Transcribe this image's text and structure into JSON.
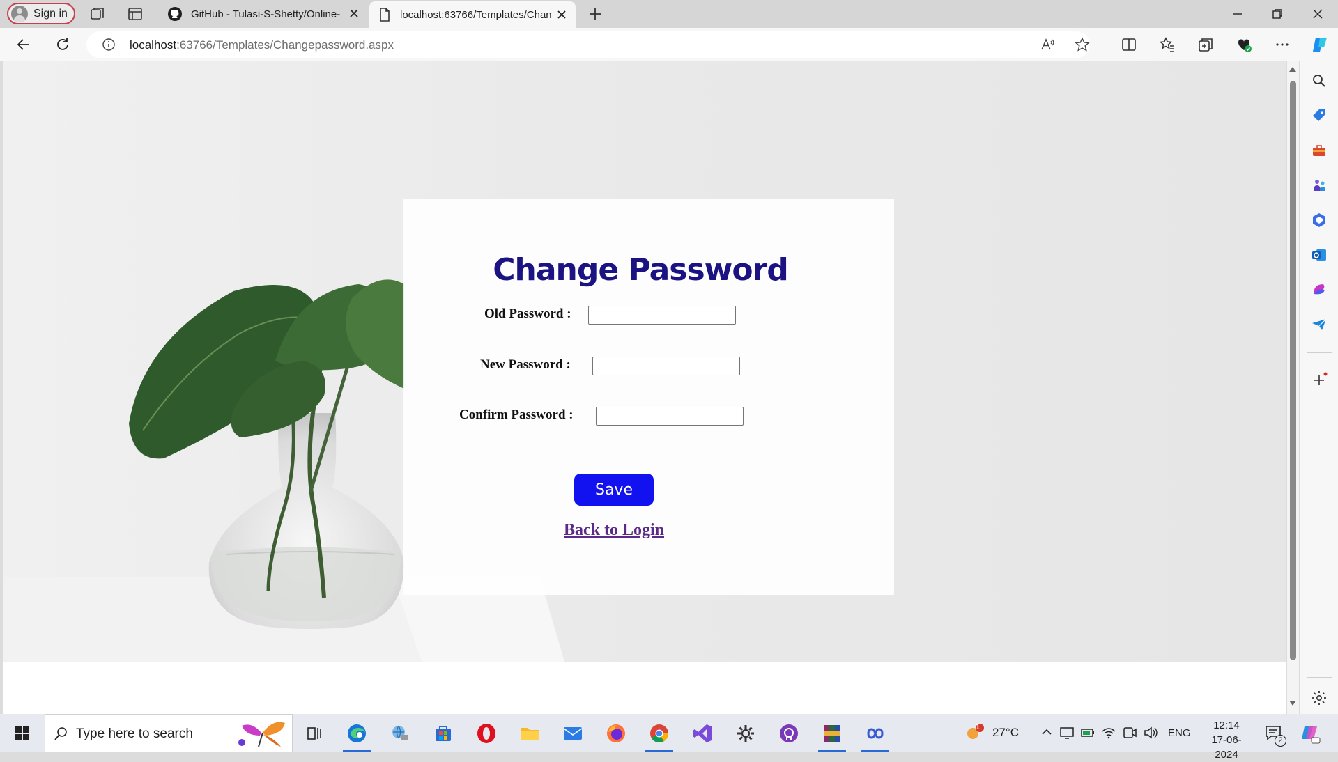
{
  "browser": {
    "signin_label": "Sign in",
    "tabs": [
      {
        "title": "GitHub - Tulasi-S-Shetty/Online-"
      },
      {
        "title": "localhost:63766/Templates/Chan"
      }
    ],
    "url_host": "localhost",
    "url_rest": ":63766/Templates/Changepassword.aspx"
  },
  "page": {
    "title": "Change Password",
    "fields": [
      {
        "label": "Old Password :",
        "value": ""
      },
      {
        "label": "New Password :",
        "value": ""
      },
      {
        "label": "Confirm Password :",
        "value": ""
      }
    ],
    "save_label": "Save",
    "back_link": "Back to Login"
  },
  "taskbar": {
    "search_placeholder": "Type here to search",
    "weather": "27°C",
    "weather_badge": "1",
    "language": "ENG",
    "time": "12:14",
    "date": "17-06-2024",
    "notification_count": "2"
  },
  "colors": {
    "title": "#1b1382",
    "save_button": "#1212f0",
    "link": "#5b2a86"
  }
}
